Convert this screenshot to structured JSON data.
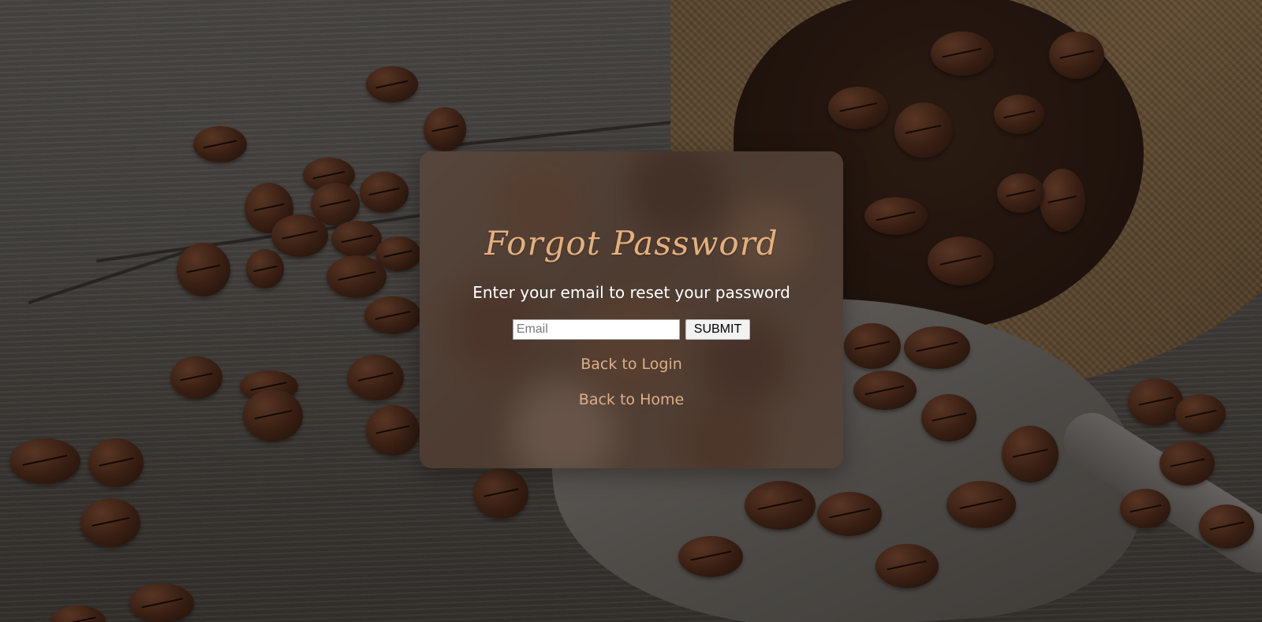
{
  "form": {
    "title": "Forgot Password",
    "subtitle": "Enter your email to reset your password",
    "email_placeholder": "Email",
    "email_value": "",
    "submit_label": "SUBMIT"
  },
  "links": {
    "back_to_login": "Back to Login",
    "back_to_home": "Back to Home"
  },
  "colors": {
    "title_accent": "#e4b07e",
    "link": "#dcb088",
    "subtitle": "#ffffff"
  }
}
